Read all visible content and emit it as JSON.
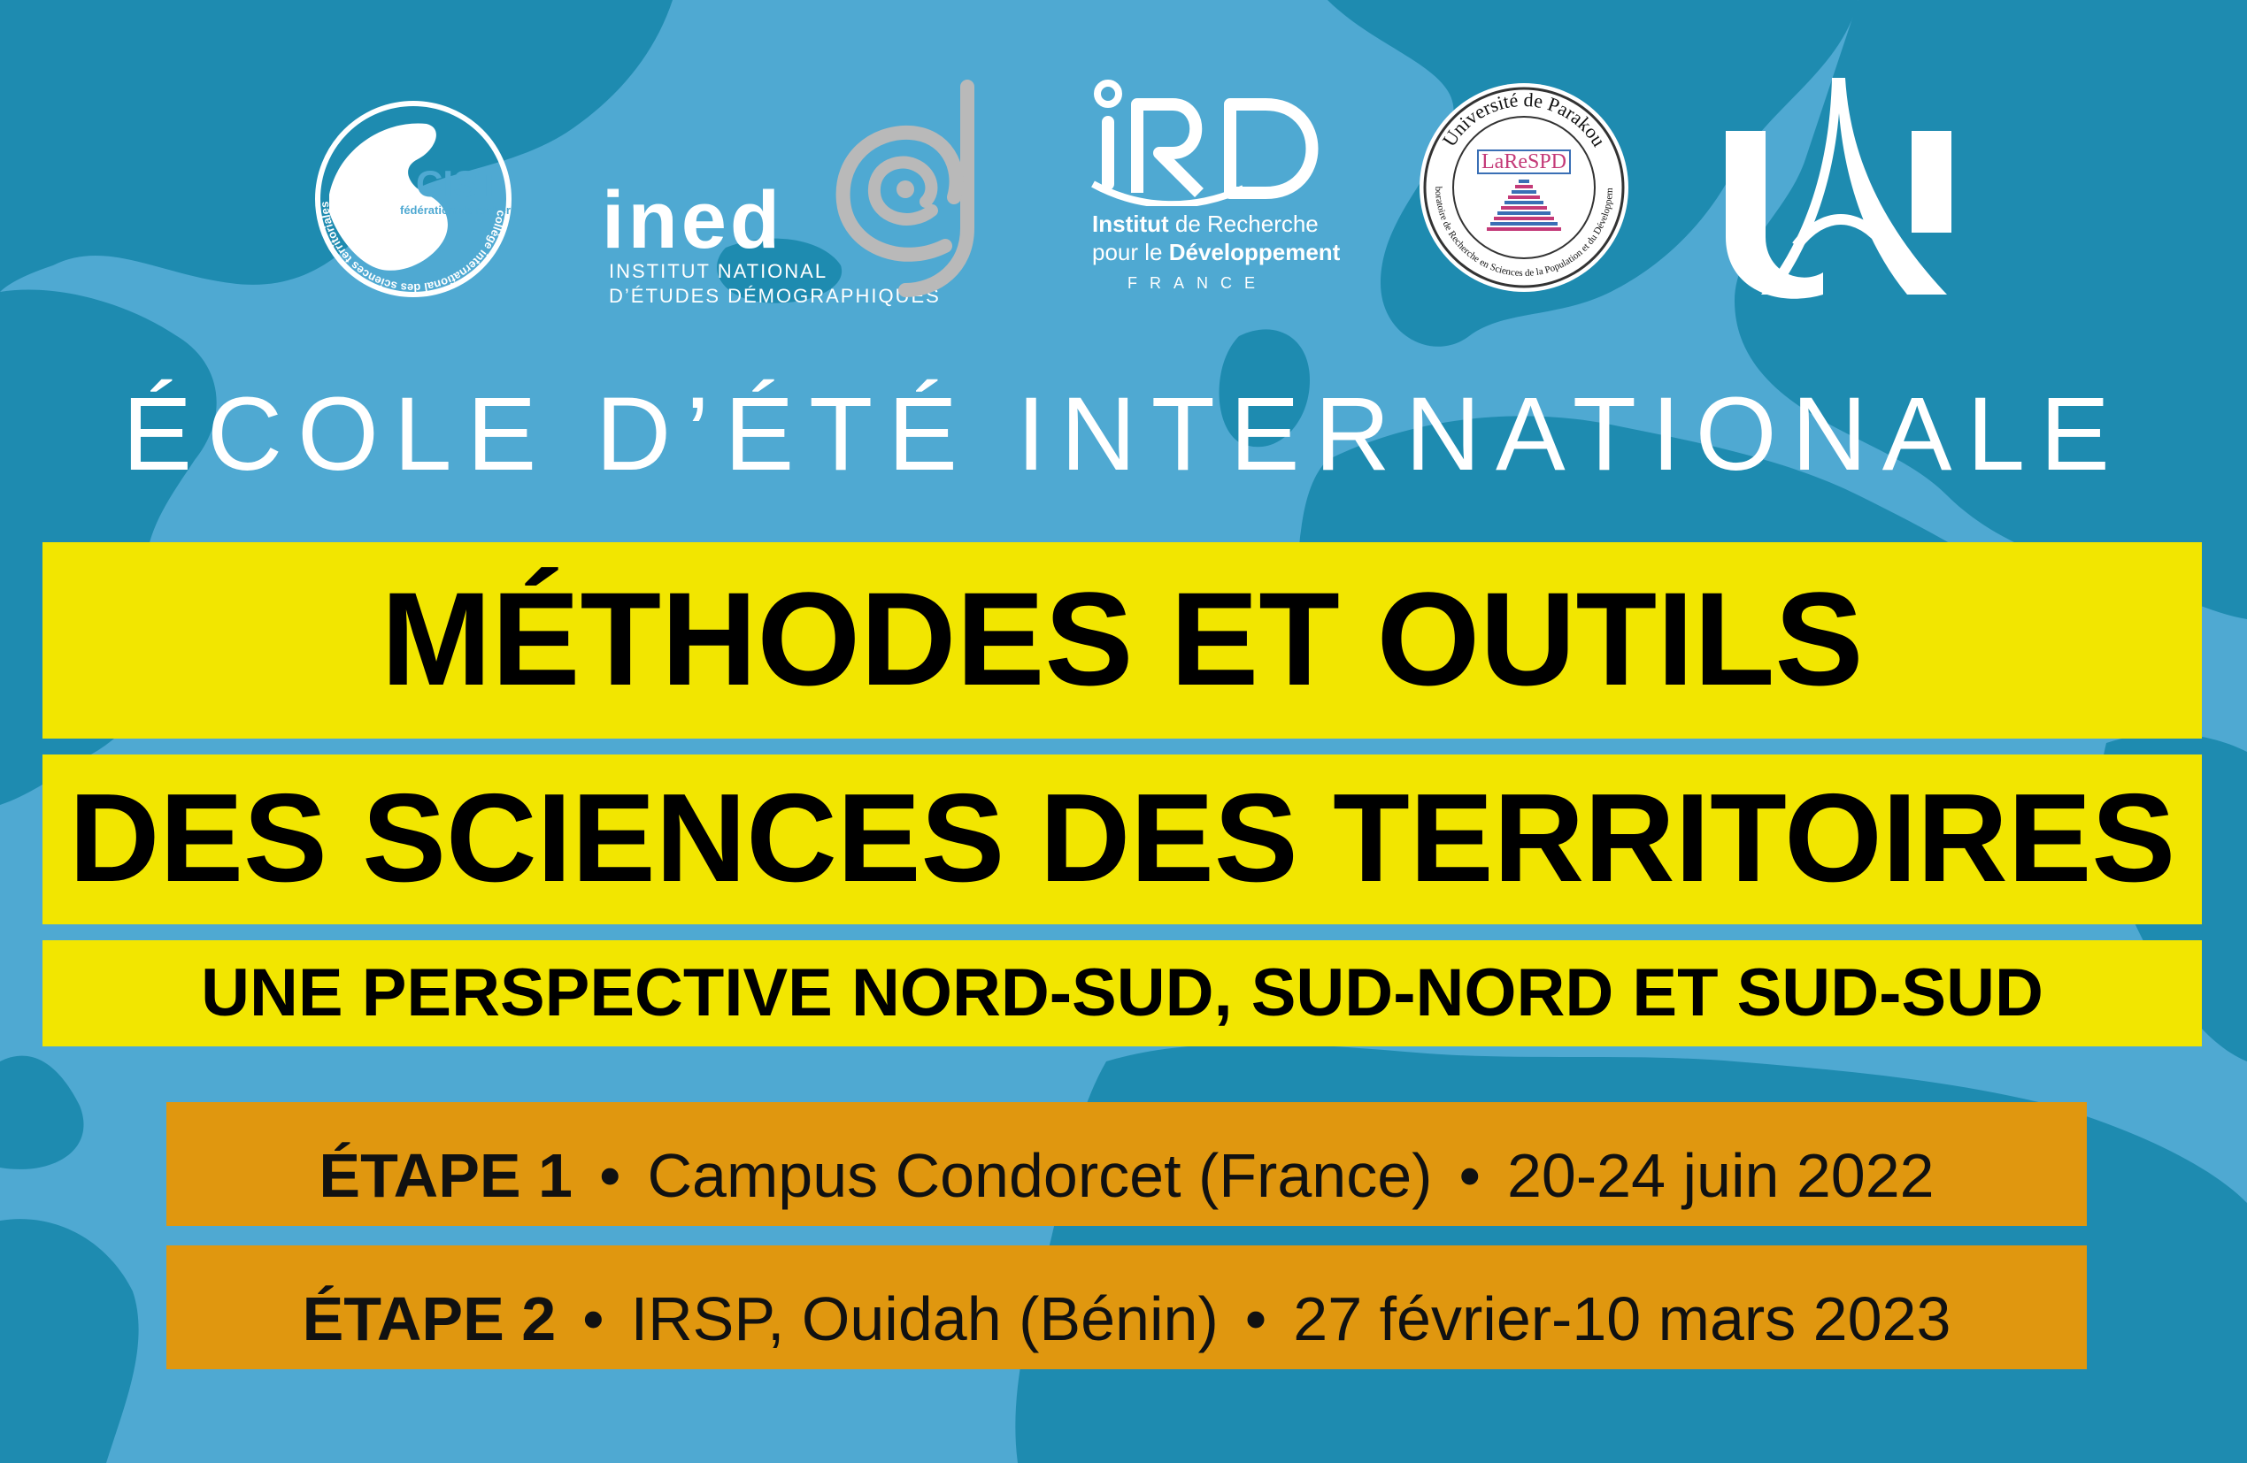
{
  "colors": {
    "background": "#4fa9d2",
    "land": "#1e8bb0",
    "title_band": "#f2e600",
    "stage_band": "#e0970f",
    "text_light": "#ffffff",
    "text_dark": "#000000",
    "ined_gray": "#b9b9b9",
    "larespd_pink": "#c43a78",
    "larespd_blue": "#3a6fb5"
  },
  "logos": {
    "cist": {
      "name": "CIST",
      "line1": "fédération de recherche",
      "ring_text": "collège international des sciences territoriales"
    },
    "ined": {
      "name": "ined",
      "line1": "INSTITUT NATIONAL",
      "line2": "D’ÉTUDES DÉMOGRAPHIQUES"
    },
    "ird": {
      "name": "IRD",
      "line1_bold": "Institut",
      "line1_rest": "de Recherche",
      "line2_rest": "pour le",
      "line2_bold": "Développement",
      "line3": "FRANCE"
    },
    "larespd": {
      "top_text": "Université de Parakou",
      "name": "LaReSPD",
      "ring_text": "Laboratoire de Recherche en Sciences de la Population et du Développement"
    },
    "ua": {
      "name": "UA"
    }
  },
  "headline": "ÉCOLE D’ÉTÉ INTERNATIONALE",
  "title": {
    "line1": "MÉTHODES ET OUTILS",
    "line2": "DES SCIENCES DES TERRITOIRES",
    "line3": "UNE PERSPECTIVE NORD-SUD, SUD-NORD ET SUD-SUD"
  },
  "stages": [
    {
      "label": "ÉTAPE 1",
      "place": "Campus Condorcet (France)",
      "dates": "20-24 juin 2022"
    },
    {
      "label": "ÉTAPE 2",
      "place": "IRSP, Ouidah (Bénin)",
      "dates": "27 février-10 mars 2023"
    }
  ],
  "separator": "•"
}
